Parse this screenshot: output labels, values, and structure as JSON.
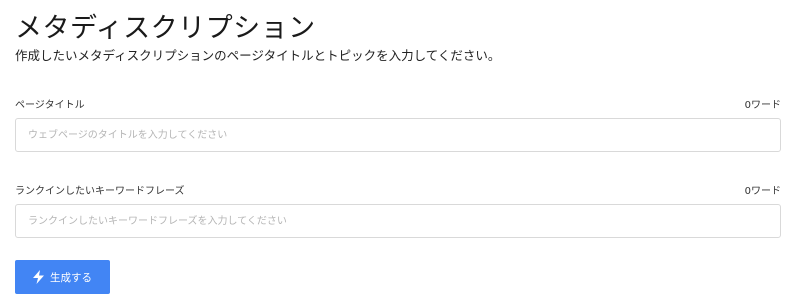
{
  "header": {
    "title": "メタディスクリプション",
    "subtitle": "作成したいメタディスクリプションのページタイトルとトピックを入力してください。"
  },
  "form": {
    "page_title_field": {
      "label": "ページタイトル",
      "word_count": "0ワード",
      "value": "",
      "placeholder": "ウェブページのタイトルを入力してください"
    },
    "keyword_field": {
      "label": "ランクインしたいキーワードフレーズ",
      "word_count": "0ワード",
      "value": "",
      "placeholder": "ランクインしたいキーワードフレーズを入力してください"
    },
    "generate_button": {
      "label": "生成する",
      "icon": "lightning-icon"
    }
  },
  "colors": {
    "accent": "#4285f4",
    "border": "#d9d9d9",
    "placeholder": "#b5b5b5"
  }
}
